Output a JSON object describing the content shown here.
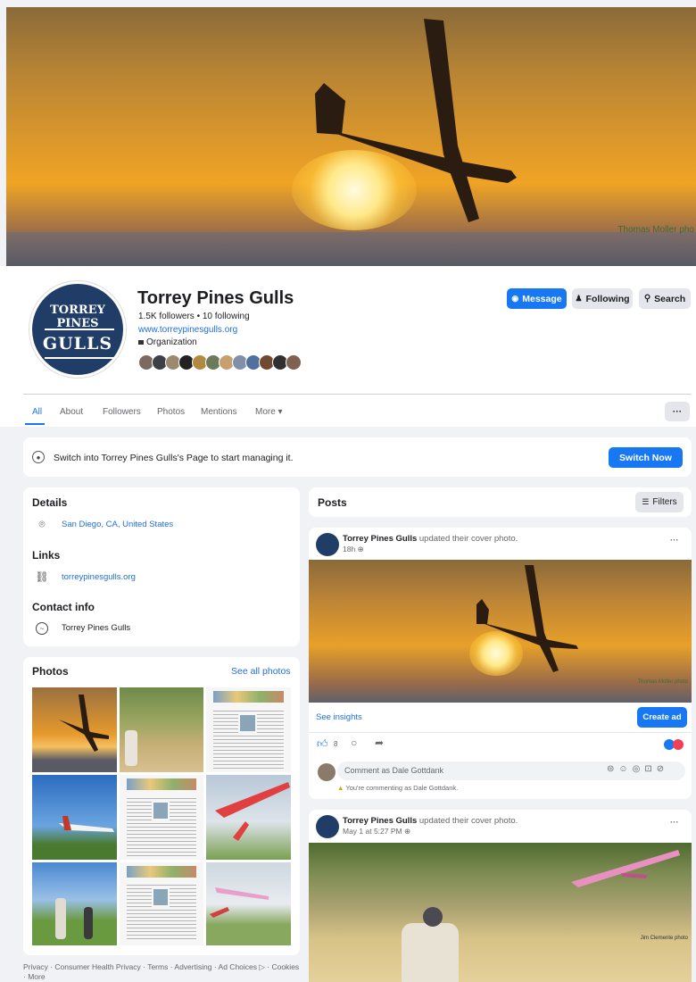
{
  "cover": {
    "credit": "Thomas Moller pho"
  },
  "logo": {
    "top_text": "TORREY PINES",
    "main_text": "GULLS"
  },
  "profile": {
    "name": "Torrey Pines Gulls",
    "followers": "1.5K followers • 10 following",
    "website": "www.torreypinesgulls.org",
    "category": "Organization"
  },
  "actions": {
    "message": "Message",
    "following": "Following",
    "search": "Search"
  },
  "tabs": [
    "All",
    "About",
    "Followers",
    "Photos",
    "Mentions",
    "More ▾"
  ],
  "more_dots": "···",
  "switch": {
    "text": "Switch into Torrey Pines Gulls's Page to start managing it.",
    "button": "Switch Now"
  },
  "details": {
    "title": "Details",
    "location": "San Diego, CA, United States",
    "links_title": "Links",
    "link": "torreypinesgulls.org",
    "contact_title": "Contact info",
    "contact": "Torrey Pines Gulls"
  },
  "photos": {
    "title": "Photos",
    "see_all": "See all photos"
  },
  "posts": {
    "title": "Posts",
    "filters": "Filters"
  },
  "post1": {
    "author": "Torrey Pines Gulls",
    "action": " updated their cover photo.",
    "time": "18h",
    "img_credit": "Thomas Moller photo",
    "insights": "See insights",
    "create_ad": "Create ad",
    "like_count": "8",
    "comment_placeholder": "Comment as Dale Gottdank",
    "commenting_note": "You're commenting as Dale Gottdank."
  },
  "post2": {
    "author": "Torrey Pines Gulls",
    "action": " updated their cover photo.",
    "time": "May 1 at 5:27 PM",
    "img_credit": "Jim Clemente photo"
  },
  "footer": "Privacy · Consumer Health Privacy · Terms · Advertising · Ad Choices ▷ · Cookies · More",
  "colors": {
    "accent": "#1877f2",
    "logo": "#1f3d66"
  }
}
